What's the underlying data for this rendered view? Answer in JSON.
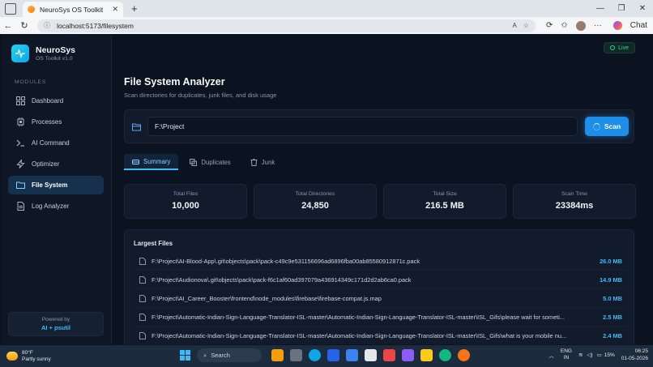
{
  "browser": {
    "tab_title": "NeuroSys OS Toolkit",
    "tab_close": "✕",
    "new_tab": "+",
    "url": "localhost:5173/filesystem",
    "chat_label": "Chat",
    "window_controls": [
      "—",
      "❐",
      "✕"
    ]
  },
  "sidebar": {
    "brand_name": "NeuroSys",
    "brand_sub": "OS Toolkit v1.0",
    "section_label": "MODULES",
    "items": [
      {
        "label": "Dashboard",
        "icon": "grid-icon",
        "active": false
      },
      {
        "label": "Processes",
        "icon": "cpu-icon",
        "active": false
      },
      {
        "label": "AI Command",
        "icon": "terminal-icon",
        "active": false
      },
      {
        "label": "Optimizer",
        "icon": "bolt-icon",
        "active": false
      },
      {
        "label": "File System",
        "icon": "folder-icon",
        "active": true
      },
      {
        "label": "Log Analyzer",
        "icon": "document-icon",
        "active": false
      }
    ],
    "powered_by": "Powered by",
    "powered_name": "AI + psutil"
  },
  "header": {
    "live_label": "Live",
    "title": "File System Analyzer",
    "subtitle": "Scan directories for duplicates, junk files, and disk usage"
  },
  "scan": {
    "path_value": "F:\\Project",
    "button_label": "Scan"
  },
  "tabs": [
    {
      "label": "Summary",
      "active": true
    },
    {
      "label": "Duplicates",
      "active": false
    },
    {
      "label": "Junk",
      "active": false
    }
  ],
  "stats": [
    {
      "label": "Total Files",
      "value": "10,000"
    },
    {
      "label": "Total Directories",
      "value": "24,850"
    },
    {
      "label": "Total Size",
      "value": "216.5 MB"
    },
    {
      "label": "Scan Time",
      "value": "23384ms"
    }
  ],
  "largest": {
    "title": "Largest Files",
    "files": [
      {
        "path": "F:\\Project\\AI-Blood-App\\.git\\objects\\pack\\pack-c49c9e531156696ad6896fba00ab85580912871c.pack",
        "size": "26.0 MB"
      },
      {
        "path": "F:\\Project\\Audionova\\.git\\objects\\pack\\pack-f6c1af60ad397079a436914349c171d2d2ab6ca0.pack",
        "size": "14.9 MB"
      },
      {
        "path": "F:\\Project\\AI_Career_Booster\\frontend\\node_modules\\firebase\\firebase-compat.js.map",
        "size": "5.0 MB"
      },
      {
        "path": "F:\\Project\\Automatic-Indian-Sign-Language-Translator-ISL-master\\Automatic-Indian-Sign-Language-Translator-ISL-master\\ISL_Gifs\\please wait for someti...",
        "size": "2.5 MB"
      },
      {
        "path": "F:\\Project\\Automatic-Indian-Sign-Language-Translator-ISL-master\\Automatic-Indian-Sign-Language-Translator-ISL-master\\ISL_Gifs\\what is your mobile nu...",
        "size": "2.4 MB"
      }
    ]
  },
  "taskbar": {
    "weather_temp": "80°F",
    "weather_desc": "Partly sunny",
    "search_label": "Search",
    "lang_1": "ENG",
    "lang_2": "IN",
    "battery": "15%",
    "time": "06:25",
    "date": "01-05-2026"
  },
  "colors": {
    "accent": "#38bdf8",
    "scan_button": "#1d8fe8",
    "live": "#34d399",
    "background": "#0b1220",
    "panel": "#121b2b"
  }
}
